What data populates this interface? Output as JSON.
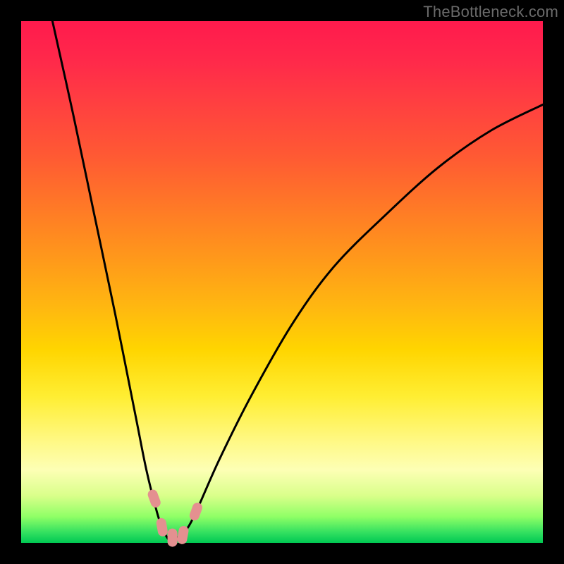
{
  "watermark": "TheBottleneck.com",
  "chart_data": {
    "type": "line",
    "title": "",
    "xlabel": "",
    "ylabel": "",
    "xlim": [
      0,
      100
    ],
    "ylim": [
      0,
      100
    ],
    "grid": false,
    "series": [
      {
        "name": "bottleneck-curve",
        "x": [
          6,
          10,
          14,
          18,
          22,
          24,
          26,
          27,
          28,
          29,
          30,
          32,
          34,
          38,
          44,
          52,
          60,
          70,
          80,
          90,
          100
        ],
        "y": [
          100,
          82,
          63,
          44,
          24,
          14,
          6,
          3,
          1,
          0,
          1,
          3,
          7,
          16,
          28,
          42,
          53,
          63,
          72,
          79,
          84
        ]
      }
    ],
    "markers": [
      {
        "x": 25.5,
        "y": 8.5
      },
      {
        "x": 27.0,
        "y": 3.0
      },
      {
        "x": 29.0,
        "y": 1.0
      },
      {
        "x": 31.0,
        "y": 1.5
      },
      {
        "x": 33.5,
        "y": 6.0
      }
    ]
  }
}
